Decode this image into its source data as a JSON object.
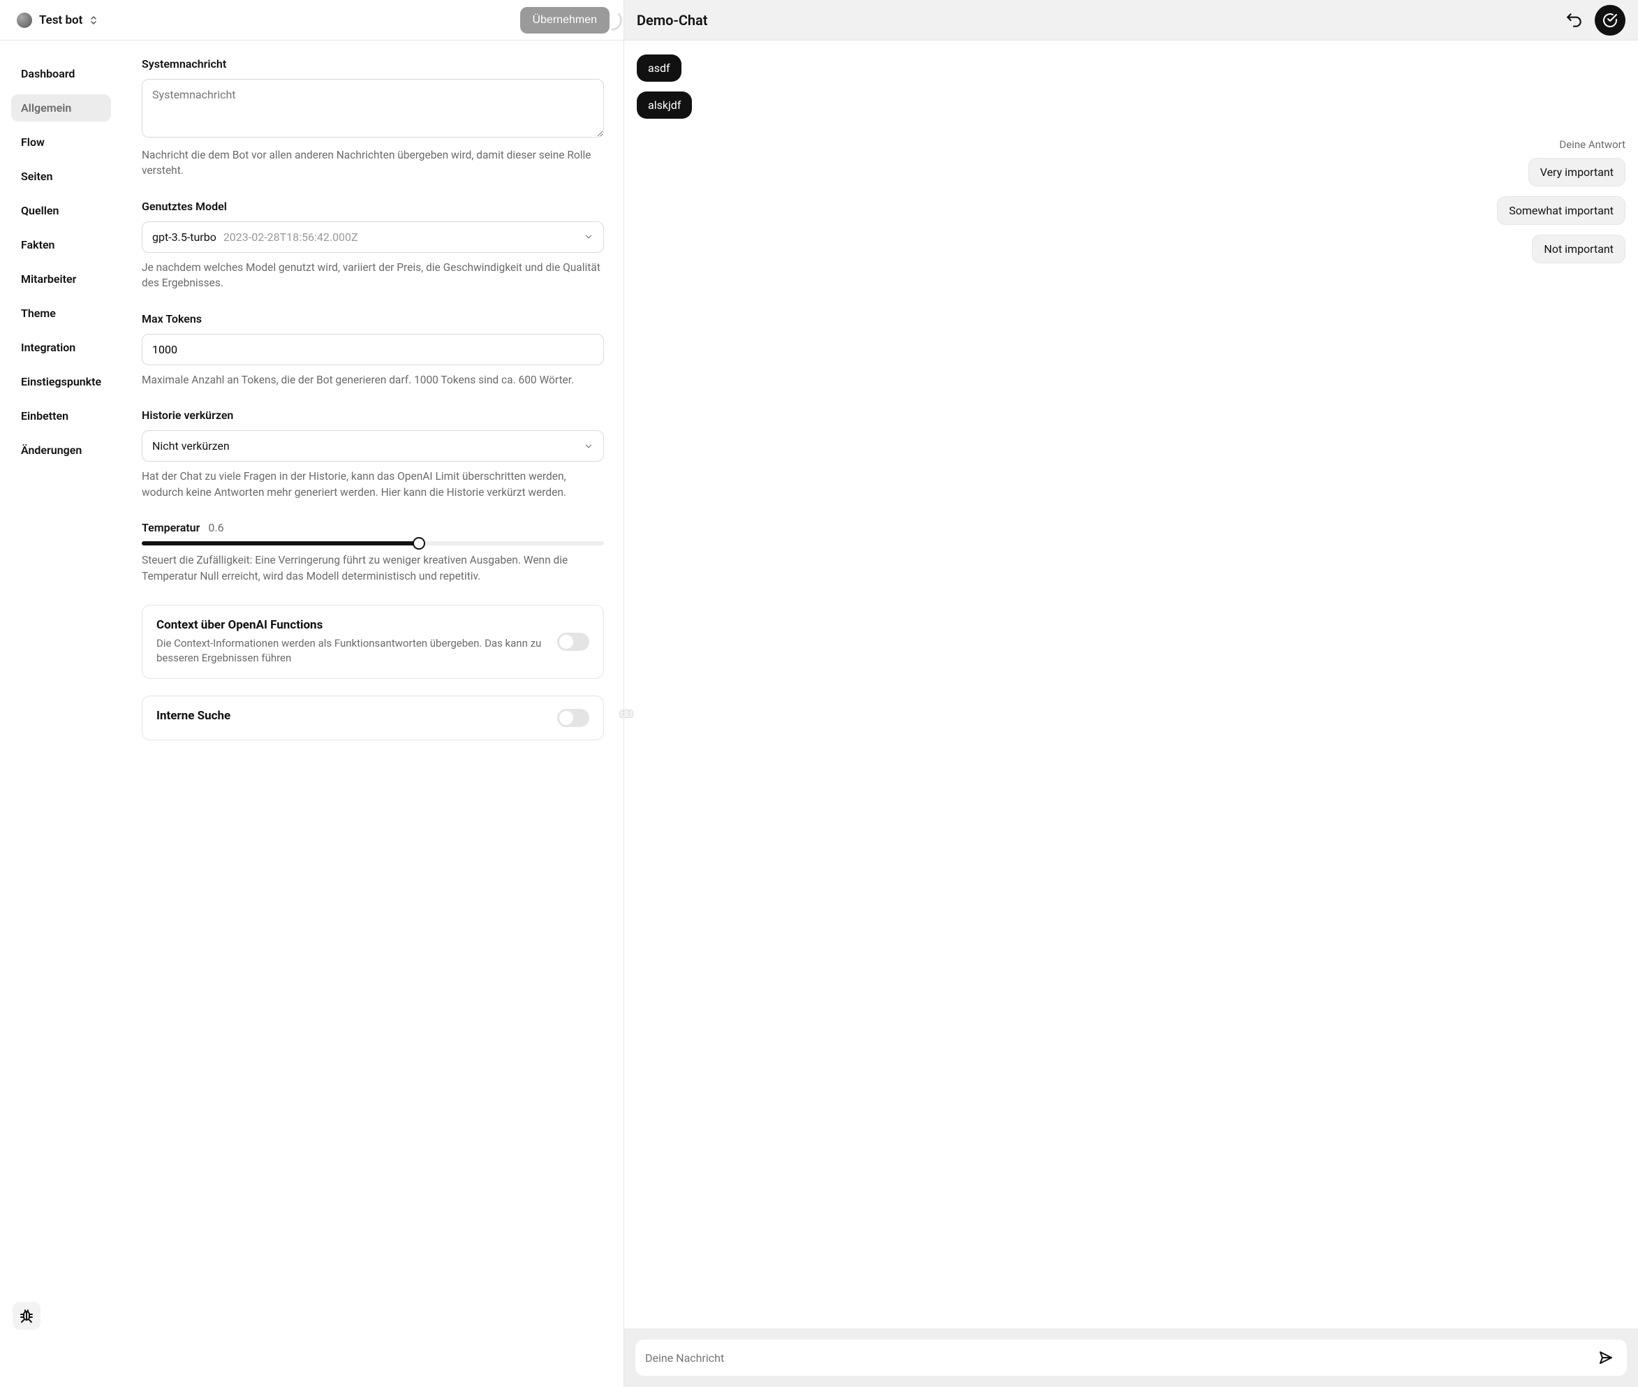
{
  "header": {
    "bot_name": "Test bot",
    "apply_label": "Übernehmen",
    "demo_title": "Demo-Chat"
  },
  "sidebar": {
    "items": [
      {
        "label": "Dashboard"
      },
      {
        "label": "Allgemein"
      },
      {
        "label": "Flow"
      },
      {
        "label": "Seiten"
      },
      {
        "label": "Quellen"
      },
      {
        "label": "Fakten"
      },
      {
        "label": "Mitarbeiter"
      },
      {
        "label": "Theme"
      },
      {
        "label": "Integration"
      },
      {
        "label": "Einstiegspunkte"
      },
      {
        "label": "Einbetten"
      },
      {
        "label": "Änderungen"
      }
    ],
    "active_index": 1
  },
  "form": {
    "system_message": {
      "label": "Systemnachricht",
      "placeholder": "Systemnachricht",
      "value": "",
      "help": "Nachricht die dem Bot vor allen anderen Nachrichten übergeben wird, damit dieser seine Rolle versteht."
    },
    "model": {
      "label": "Genutztes Model",
      "value": "gpt-3.5-turbo",
      "date": "2023-02-28T18:56:42.000Z",
      "help": "Je nachdem welches Model genutzt wird, variiert der Preis, die Geschwindigkeit und die Qualität des Ergebnisses."
    },
    "max_tokens": {
      "label": "Max Tokens",
      "value": "1000",
      "help": "Maximale Anzahl an Tokens, die der Bot generieren darf. 1000 Tokens sind ca. 600 Wörter."
    },
    "history": {
      "label": "Historie verkürzen",
      "value": "Nicht verkürzen",
      "help": "Hat der Chat zu viele Fragen in der Historie, kann das OpenAI Limit überschritten werden, wodurch keine Antworten mehr generiert werden. Hier kann die Historie verkürzt werden."
    },
    "temperature": {
      "label": "Temperatur",
      "value": "0.6",
      "percent": 60,
      "help": "Steuert die Zufälligkeit: Eine Verringerung führt zu weniger kreativen Ausgaben. Wenn die Temperatur Null erreicht, wird das Modell deterministisch und repetitiv."
    },
    "context_functions": {
      "title": "Context über OpenAI Functions",
      "desc": "Die Context-Informationen werden als Funktionsantworten übergeben. Das kann zu besseren Ergebnissen führen",
      "enabled": false
    },
    "internal_search": {
      "title": "Interne Suche"
    }
  },
  "chat": {
    "messages": [
      {
        "role": "bot",
        "text": "asdf"
      },
      {
        "role": "bot",
        "text": "alskjdf"
      }
    ],
    "answer_label": "Deine Antwort",
    "options": [
      "Very important",
      "Somewhat important",
      "Not important"
    ],
    "input_placeholder": "Deine Nachricht"
  }
}
